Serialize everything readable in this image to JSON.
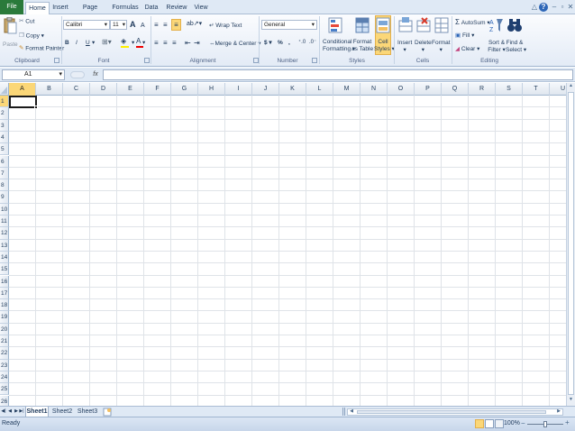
{
  "tabs": {
    "file": "File",
    "home": "Home",
    "insert": "Insert",
    "page_layout": "Page Layout",
    "formulas": "Formulas",
    "data": "Data",
    "review": "Review",
    "view": "View"
  },
  "clipboard": {
    "paste": "Paste",
    "cut": "Cut",
    "copy": "Copy",
    "format_painter": "Format Painter",
    "label": "Clipboard"
  },
  "font": {
    "name": "Calibri",
    "size": "11",
    "bold": "B",
    "italic": "I",
    "underline": "U",
    "grow": "A",
    "shrink": "A",
    "label": "Font"
  },
  "alignment": {
    "wrap_text": "Wrap Text",
    "merge_center": "Merge & Center",
    "label": "Alignment"
  },
  "number": {
    "format": "General",
    "currency": "$",
    "percent": "%",
    "comma": ",",
    "label": "Number"
  },
  "styles": {
    "conditional_1": "Conditional",
    "conditional_2": "Formatting",
    "format_table_1": "Format",
    "format_table_2": "as Table",
    "cell_styles_1": "Cell",
    "cell_styles_2": "Styles",
    "label": "Styles"
  },
  "cells": {
    "insert": "Insert",
    "delete": "Delete",
    "format": "Format",
    "label": "Cells"
  },
  "editing": {
    "autosum": "AutoSum",
    "fill": "Fill",
    "clear": "Clear",
    "sort_1": "Sort &",
    "sort_2": "Filter",
    "find_1": "Find &",
    "find_2": "Select",
    "label": "Editing"
  },
  "formula_bar": {
    "name_box": "A1",
    "fx": "fx",
    "value": ""
  },
  "columns": [
    "A",
    "B",
    "C",
    "D",
    "E",
    "F",
    "G",
    "H",
    "I",
    "J",
    "K",
    "L",
    "M",
    "N",
    "O",
    "P",
    "Q",
    "R",
    "S",
    "T",
    "U"
  ],
  "rows": [
    "1",
    "2",
    "3",
    "4",
    "5",
    "6",
    "7",
    "8",
    "9",
    "10",
    "11",
    "12",
    "13",
    "14",
    "15",
    "16",
    "17",
    "18",
    "19",
    "20",
    "21",
    "22",
    "23",
    "24",
    "25",
    "26"
  ],
  "active_cell": "A1",
  "sheets": [
    "Sheet1",
    "Sheet2",
    "Sheet3"
  ],
  "active_sheet": "Sheet1",
  "status": {
    "ready": "Ready",
    "zoom": "100%"
  },
  "colors": {
    "file_tab": "#2a7a3b",
    "selection_header": "#fbd778",
    "ribbon_bg": "#e3ebf6"
  }
}
